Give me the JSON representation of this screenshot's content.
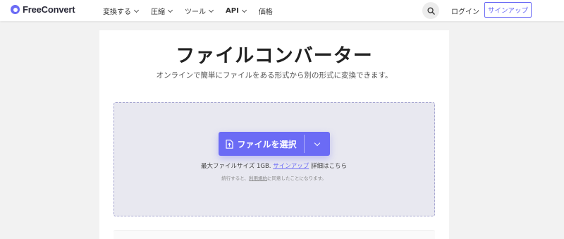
{
  "header": {
    "logo_text": "FreeConvert",
    "nav": [
      {
        "label": "変換する",
        "dropdown": true
      },
      {
        "label": "圧縮",
        "dropdown": true
      },
      {
        "label": "ツール",
        "dropdown": true
      },
      {
        "label": "API",
        "dropdown": true
      },
      {
        "label": "価格",
        "dropdown": false
      }
    ],
    "login_label": "ログイン",
    "signup_label": "サインアップ"
  },
  "main": {
    "title": "ファイルコンバーター",
    "subtitle": "オンラインで簡単にファイルをある形式から別の形式に変換できます。",
    "dropzone": {
      "choose_label": "ファイルを選択",
      "max_prefix": "最大ファイルサイズ 1GB.",
      "max_link": "サインアップ",
      "max_suffix": "詳細はこちら",
      "terms_prefix": "続行すると、",
      "terms_link": "利用規約",
      "terms_suffix": "に同意したことになります。"
    }
  },
  "colors": {
    "accent": "#6b6bf5",
    "background": "#f2f2f2",
    "dropzone": "#e8e8f0"
  }
}
